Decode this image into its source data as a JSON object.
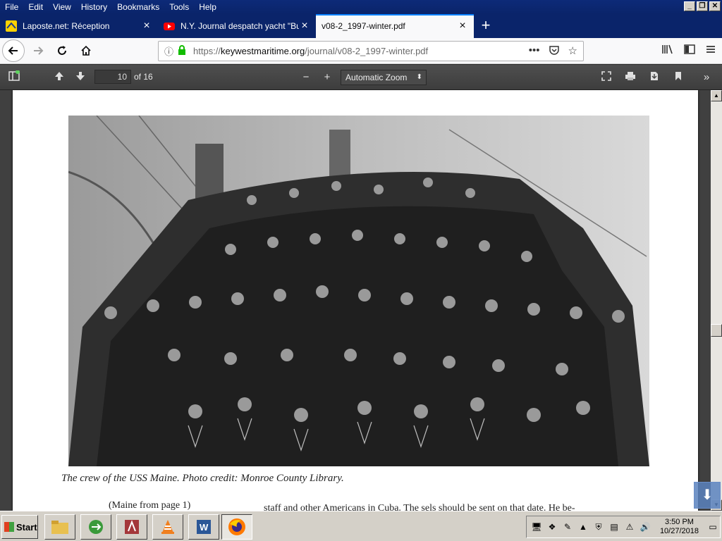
{
  "menubar": {
    "items": [
      {
        "label": "File"
      },
      {
        "label": "Edit"
      },
      {
        "label": "View"
      },
      {
        "label": "History"
      },
      {
        "label": "Bookmarks"
      },
      {
        "label": "Tools"
      },
      {
        "label": "Help"
      }
    ]
  },
  "tabs": [
    {
      "title": "Laposte.net: Réception",
      "icon": "laposte-icon",
      "active": false
    },
    {
      "title": "N.Y. Journal despatch yacht \"Bucc",
      "icon": "youtube-icon",
      "active": false
    },
    {
      "title": "v08-2_1997-winter.pdf",
      "icon": "",
      "active": true
    }
  ],
  "navbar": {
    "url_prefix": "https://",
    "url_domain": "keywestmaritime.org",
    "url_path": "/journal/v08-2_1997-winter.pdf"
  },
  "pdf_toolbar": {
    "page_number": "10",
    "page_count": "of 16",
    "zoom": "Automatic Zoom"
  },
  "document": {
    "caption": "The crew of the USS Maine. Photo credit: Monroe County Library.",
    "text_left": "(Maine from page 1)",
    "text_right": "staff and other Americans in Cuba.  The     sels should be sent on that date.  He be-"
  },
  "taskbar": {
    "start_label": "Start",
    "clock_time": "3:50 PM",
    "clock_date": "10/27/2018"
  },
  "colors": {
    "titlebar": "#0a246a",
    "tab_active": "#f9f9fa",
    "pdf_toolbar": "#474747",
    "taskbar": "#d4d0c8"
  }
}
